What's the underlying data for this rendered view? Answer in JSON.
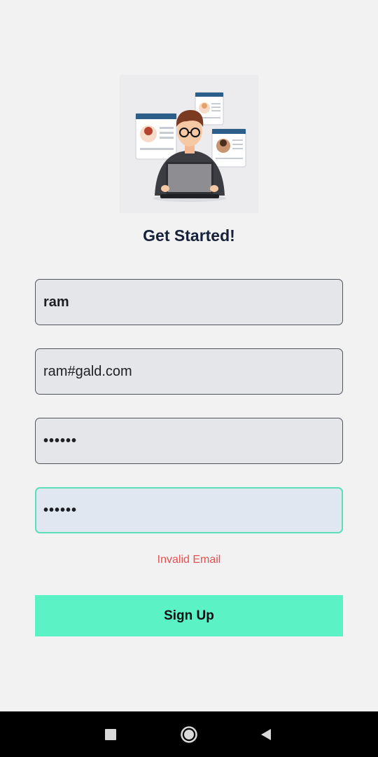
{
  "title": "Get Started!",
  "form": {
    "name_value": "ram",
    "email_value": "ram#gald.com",
    "password_value": "••••••",
    "confirm_password_value": "••••••",
    "error_text": "Invalid Email",
    "signup_label": "Sign Up"
  },
  "colors": {
    "background": "#f2f2f2",
    "field_bg": "#e5e6ea",
    "focus_border": "#5eddb9",
    "button_bg": "#5bf2c6",
    "error": "#e35151"
  },
  "navbar": {
    "icons": [
      "recent-apps-icon",
      "home-icon",
      "back-icon"
    ]
  }
}
